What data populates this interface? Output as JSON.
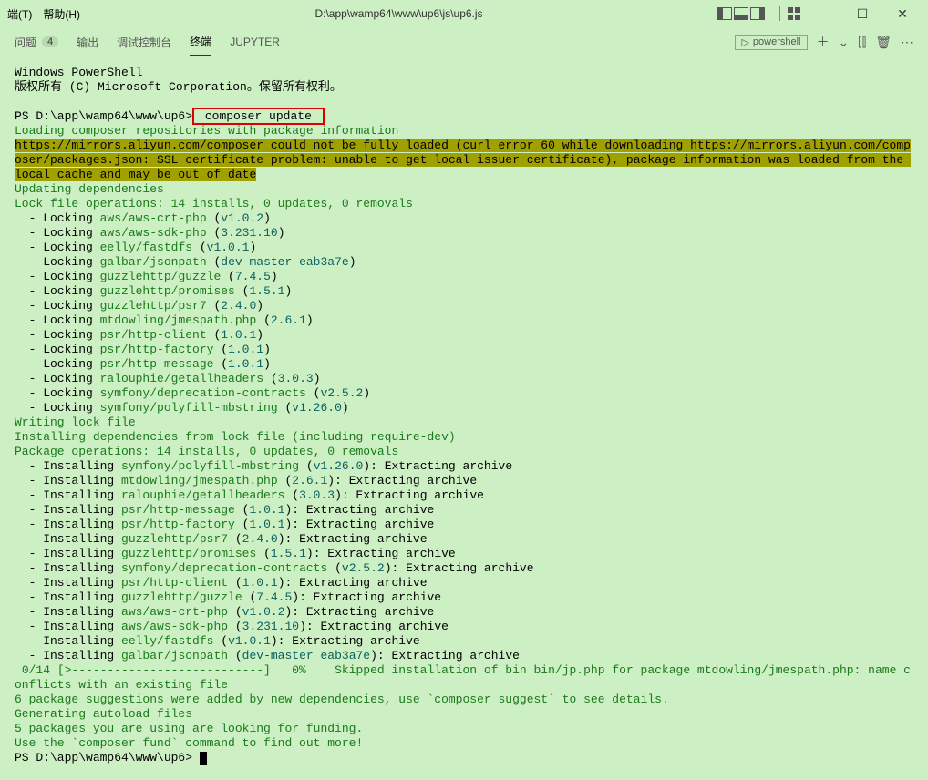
{
  "titlebar": {
    "menu_terminal": "端(T)",
    "menu_help": "帮助(H)",
    "filepath": "D:\\app\\wamp64\\www\\up6\\js\\up6.js"
  },
  "tabs": {
    "problems": "问题",
    "problems_count": "4",
    "output": "输出",
    "debug": "调试控制台",
    "terminal": "终端",
    "jupyter": "JUPYTER",
    "shell_label": "powershell"
  },
  "term": {
    "l1": "Windows PowerShell",
    "l2": "版权所有 (C) Microsoft Corporation。保留所有权利。",
    "prompt1_a": "PS D:\\app\\wamp64\\www\\up6>",
    "prompt1_cmd": " composer update ",
    "loading": "Loading composer repositories with package information",
    "warn": "https://mirrors.aliyun.com/composer could not be fully loaded (curl error 60 while downloading https://mirrors.aliyun.com/composer/packages.json: SSL certificate problem: unable to get local issuer certificate), package information was loaded from the local cache and may be out of date",
    "updating": "Updating dependencies",
    "lockops": "Lock file operations: 14 installs, 0 updates, 0 removals",
    "lock": [
      {
        "pkg": "aws/aws-crt-php",
        "v": "v1.0.2"
      },
      {
        "pkg": "aws/aws-sdk-php",
        "v": "3.231.10"
      },
      {
        "pkg": "eelly/fastdfs",
        "v": "v1.0.1"
      },
      {
        "pkg": "galbar/jsonpath",
        "v": "dev-master eab3a7e"
      },
      {
        "pkg": "guzzlehttp/guzzle",
        "v": "7.4.5"
      },
      {
        "pkg": "guzzlehttp/promises",
        "v": "1.5.1"
      },
      {
        "pkg": "guzzlehttp/psr7",
        "v": "2.4.0"
      },
      {
        "pkg": "mtdowling/jmespath.php",
        "v": "2.6.1"
      },
      {
        "pkg": "psr/http-client",
        "v": "1.0.1"
      },
      {
        "pkg": "psr/http-factory",
        "v": "1.0.1"
      },
      {
        "pkg": "psr/http-message",
        "v": "1.0.1"
      },
      {
        "pkg": "ralouphie/getallheaders",
        "v": "3.0.3"
      },
      {
        "pkg": "symfony/deprecation-contracts",
        "v": "v2.5.2"
      },
      {
        "pkg": "symfony/polyfill-mbstring",
        "v": "v1.26.0"
      }
    ],
    "writing": "Writing lock file",
    "installing_hdr": "Installing dependencies from lock file (including require-dev)",
    "pkgops": "Package operations: 14 installs, 0 updates, 0 removals",
    "install": [
      {
        "pkg": "symfony/polyfill-mbstring",
        "v": "v1.26.0"
      },
      {
        "pkg": "mtdowling/jmespath.php",
        "v": "2.6.1"
      },
      {
        "pkg": "ralouphie/getallheaders",
        "v": "3.0.3"
      },
      {
        "pkg": "psr/http-message",
        "v": "1.0.1"
      },
      {
        "pkg": "psr/http-factory",
        "v": "1.0.1"
      },
      {
        "pkg": "guzzlehttp/psr7",
        "v": "2.4.0"
      },
      {
        "pkg": "guzzlehttp/promises",
        "v": "1.5.1"
      },
      {
        "pkg": "symfony/deprecation-contracts",
        "v": "v2.5.2"
      },
      {
        "pkg": "psr/http-client",
        "v": "1.0.1"
      },
      {
        "pkg": "guzzlehttp/guzzle",
        "v": "7.4.5"
      },
      {
        "pkg": "aws/aws-crt-php",
        "v": "v1.0.2"
      },
      {
        "pkg": "aws/aws-sdk-php",
        "v": "3.231.10"
      },
      {
        "pkg": "eelly/fastdfs",
        "v": "v1.0.1"
      },
      {
        "pkg": "galbar/jsonpath",
        "v": "dev-master eab3a7e"
      }
    ],
    "extract": ": Extracting archive",
    "progress": " 0/14 [>---------------------------]   0%    Skipped installation of bin bin/jp.php for package mtdowling/jmespath.php: name conflicts with an existing file",
    "sugg": "6 package suggestions were added by new dependencies, use `composer suggest` to see details.",
    "autoload": "Generating autoload files",
    "funding1": "5 packages you are using are looking for funding.",
    "funding2": "Use the `composer fund` command to find out more!",
    "prompt2": "PS D:\\app\\wamp64\\www\\up6> "
  }
}
